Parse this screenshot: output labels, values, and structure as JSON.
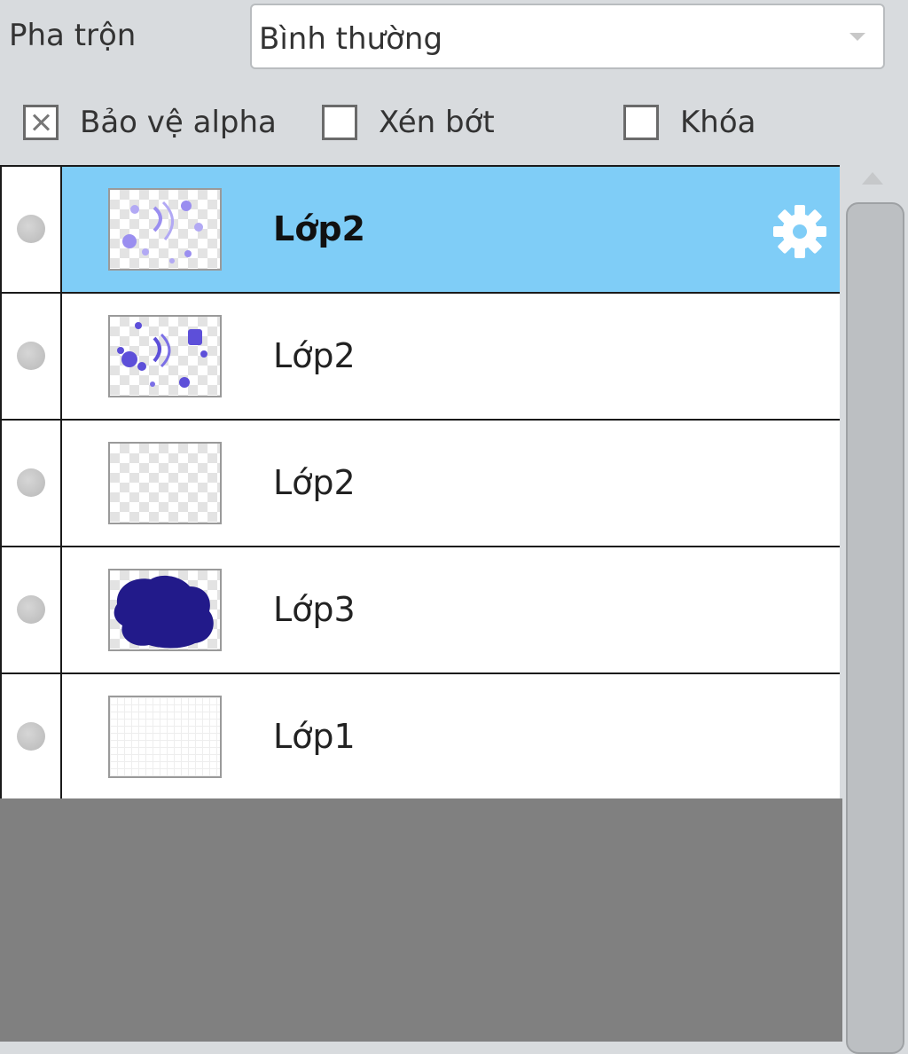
{
  "blend": {
    "label": "Pha trộn",
    "value": "Bình thường"
  },
  "options": [
    {
      "label": "Bảo vệ alpha",
      "checked": true
    },
    {
      "label": "Xén bớt",
      "checked": false
    },
    {
      "label": "Khóa",
      "checked": false
    }
  ],
  "layers": [
    {
      "name": "Lớp2",
      "selected": true,
      "thumbnail": "light-purple-spots"
    },
    {
      "name": "Lớp2",
      "selected": false,
      "thumbnail": "purple-spots"
    },
    {
      "name": "Lớp2",
      "selected": false,
      "thumbnail": "empty-transparent"
    },
    {
      "name": "Lớp3",
      "selected": false,
      "thumbnail": "dark-blue-blob"
    },
    {
      "name": "Lớp1",
      "selected": false,
      "thumbnail": "white-paper"
    }
  ],
  "colors": {
    "selected_row": "#7fcdf7",
    "paint_light": "#9a8ef0",
    "paint_mid": "#5d4fd9",
    "paint_dark": "#221a8a"
  },
  "icons": {
    "layer_settings": "gear-icon",
    "visibility": "eye-dot-icon"
  }
}
